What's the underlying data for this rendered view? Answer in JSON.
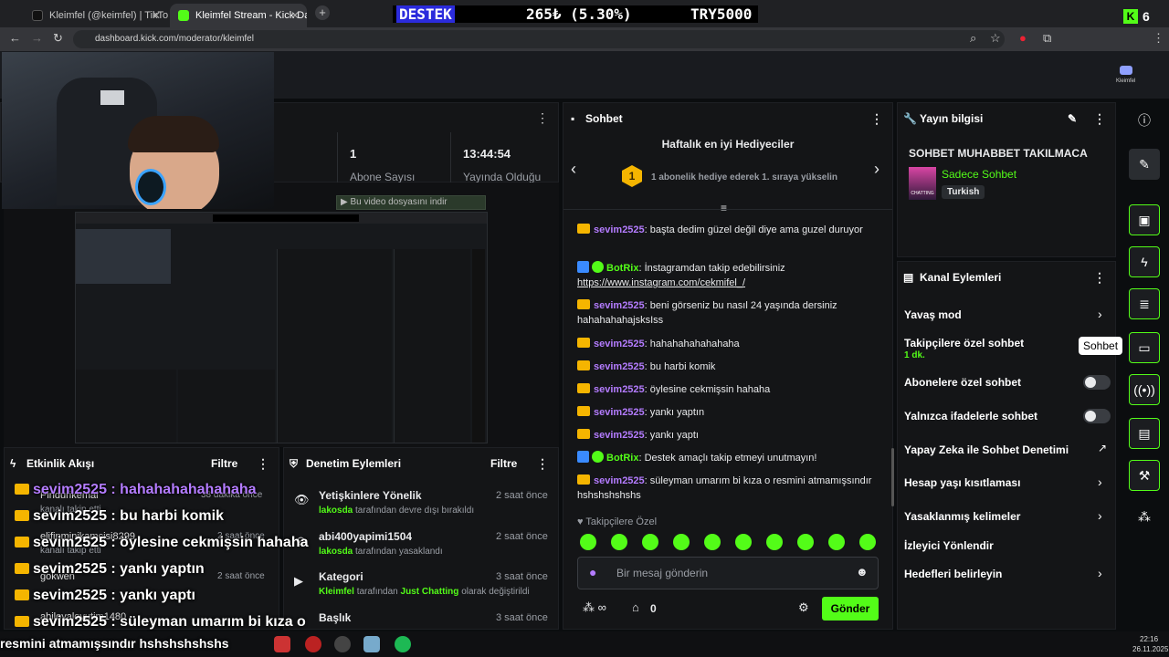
{
  "browser": {
    "tabs": [
      {
        "title": "Kleimfel (@keimfel) | TikTok"
      },
      {
        "title": "Kleimfel Stream - Kick Dashboa"
      }
    ],
    "ticker": {
      "label": "DESTEK",
      "amount": "265₺ (5.30%)",
      "goal": "TRY5000"
    },
    "url": "dashboard.kick.com/moderator/kleimfel",
    "badge_count": "6"
  },
  "kick": {
    "profile_name": "Kleimfel",
    "stats": {
      "value1": "1",
      "value2": "13:44:54",
      "label1": "Abone Sayısı",
      "label2": "Yayında Olduğu"
    },
    "video_download": "Bu video dosyasını indir"
  },
  "chat": {
    "title": "Sohbet",
    "gifters_title": "Haftalık en iyi Hediyeciler",
    "gifters_rank": "1",
    "gifters_text": "1 abonelik hediye ederek 1. sıraya yükselin",
    "messages": [
      {
        "user": "sevim2525",
        "text": ": başta dedim güzel değil diye ama guzel duruyor"
      },
      {
        "user": "BotRix",
        "text": ": İnstagramdan takip edebilirsiniz",
        "link": "https://www.instagram.com/cekmifel_/"
      },
      {
        "user": "sevim2525",
        "text": ": beni görseniz bu nasıl 24 yaşında dersiniz hahahahahajsksIss"
      },
      {
        "user": "sevim2525",
        "text": ": hahahahahahahaha"
      },
      {
        "user": "sevim2525",
        "text": ": bu harbi komik"
      },
      {
        "user": "sevim2525",
        "text": ": öylesine cekmişsin hahaha"
      },
      {
        "user": "sevim2525",
        "text": ": yankı yaptın"
      },
      {
        "user": "sevim2525",
        "text": ": yankı yaptı"
      },
      {
        "user": "BotRix",
        "text": ": Destek amaçlı takip etmeyi unutmayın!"
      },
      {
        "user": "sevim2525",
        "text": ": süleyman umarım bi kıza o resmini atmamışsındır hshshshshshs"
      }
    ],
    "followers_only": "Takipçilere Özel",
    "input_placeholder": "Bir mesaj gönderin",
    "points": "0",
    "send": "Gönder"
  },
  "stream_info": {
    "title": "Yayın bilgisi",
    "stream_title": "SOHBET MUHABBET TAKILMACA",
    "category": "Sadece Sohbet",
    "language": "Turkish",
    "thumb_text": "CHATTING"
  },
  "channel_actions": {
    "title": "Kanal Eylemleri",
    "items": [
      {
        "label": "Yavaş mod"
      },
      {
        "label": "Takipçilere özel sohbet",
        "sub": "1 dk."
      },
      {
        "label": "Abonelere özel sohbet"
      },
      {
        "label": "Yalnızca ifadelerle sohbet"
      },
      {
        "label": "Yapay Zeka ile Sohbet Denetimi"
      },
      {
        "label": "Hesap yaşı kısıtlaması"
      },
      {
        "label": "Yasaklanmış kelimeler"
      },
      {
        "label": "İzleyici Yönlendir"
      },
      {
        "label": "Hedefleri belirleyin"
      }
    ],
    "tooltip": "Sohbet"
  },
  "activity": {
    "title": "Etkinlik Akışı",
    "filter": "Filtre",
    "items": [
      {
        "name": "Pindurikemal",
        "action": "kanalı takip etti",
        "time": "38 dakika önce"
      },
      {
        "name": "elifinminikamcisi8299",
        "action": "kanalı takip etti",
        "time": "2 saat önce"
      },
      {
        "name": "gokwen",
        "action": "",
        "time": "2 saat önce"
      },
      {
        "name": "abiloyaloyutim1480",
        "action": "",
        "time": ""
      }
    ]
  },
  "moderation": {
    "title": "Denetim Eylemleri",
    "filter": "Filtre",
    "items": [
      {
        "title": "Yetişkinlere Yönelik",
        "actor": "lakosda",
        "desc": "tarafından devre dışı bırakıldı",
        "time": "2 saat önce"
      },
      {
        "title": "abi400yapimi1504",
        "actor": "lakosda",
        "desc": "tarafından yasaklandı",
        "time": "2 saat önce"
      },
      {
        "title": "Kategori",
        "actor": "Kleimfel",
        "desc": "tarafından",
        "cat": "Just Chatting",
        "desc2": "olarak değiştirildi",
        "time": "3 saat önce"
      },
      {
        "title": "Başlık",
        "time": "3 saat önce"
      }
    ]
  },
  "overlay_chat": [
    "sevim2525 : hahahahahahahaha",
    "sevim2525 : bu harbi komik",
    "sevim2525 : öylesine cekmişsin hahaha",
    "sevim2525 : yankı yaptın",
    "sevim2525 : yankı yaptı",
    "sevim2525 : süleyman umarım bi kıza o",
    "resmini atmamışsındır hshshshshshs"
  ],
  "taskbar": {
    "time": "22:16",
    "date": "26.11.2025"
  },
  "colors": {
    "accent": "#53fc18",
    "username": "#b47cff",
    "panel": "#141517"
  }
}
